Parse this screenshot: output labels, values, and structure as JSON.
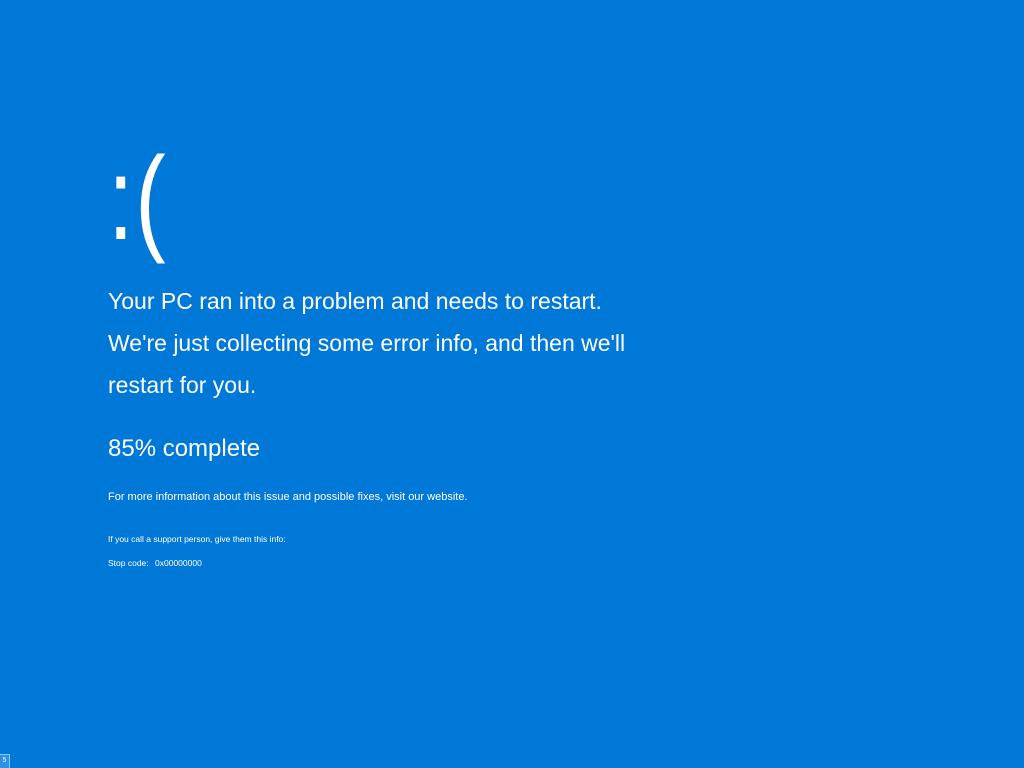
{
  "screen": {
    "background_color": "#0078d7",
    "text_color": "#ffffff"
  },
  "error": {
    "sad_face": ":(",
    "message": "Your PC ran into a problem and needs to restart. We're just collecting some error info, and then we'll restart for you.",
    "progress_percent": 85,
    "progress_text": "85% complete",
    "more_info_text": "For more information about this issue and possible fixes, visit our website.",
    "support_text": "If you call a support person, give them this info:",
    "stop_code_label": "Stop code:",
    "stop_code_value": "0x00000000"
  },
  "corner_indicator": {
    "label": "5"
  }
}
